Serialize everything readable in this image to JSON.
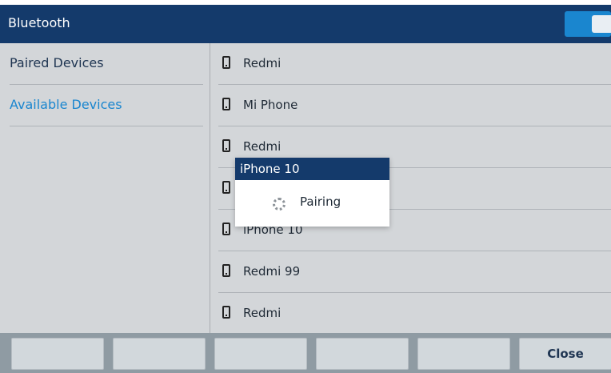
{
  "header": {
    "title": "Bluetooth",
    "toggle_on": true
  },
  "sidebar": {
    "items": [
      {
        "label": "Paired Devices"
      },
      {
        "label": "Available Devices"
      }
    ]
  },
  "devices": [
    {
      "label": "Redmi",
      "icon": "phone-icon"
    },
    {
      "label": "Mi Phone",
      "icon": "phone-icon"
    },
    {
      "label": "Redmi",
      "icon": "phone-icon"
    },
    {
      "label": "",
      "icon": "phone-icon"
    },
    {
      "label": "iPhone 10",
      "icon": "phone-icon"
    },
    {
      "label": "Redmi 99",
      "icon": "phone-icon"
    },
    {
      "label": "Redmi",
      "icon": "phone-icon"
    }
  ],
  "popup": {
    "title": "iPhone 10",
    "status": "Pairing"
  },
  "softkeys": [
    {
      "label": ""
    },
    {
      "label": ""
    },
    {
      "label": ""
    },
    {
      "label": ""
    },
    {
      "label": ""
    },
    {
      "label": "Close"
    }
  ],
  "colors": {
    "header_bg": "#143a6b",
    "accent": "#1a86cf",
    "panel_bg": "#d3d6d9"
  }
}
